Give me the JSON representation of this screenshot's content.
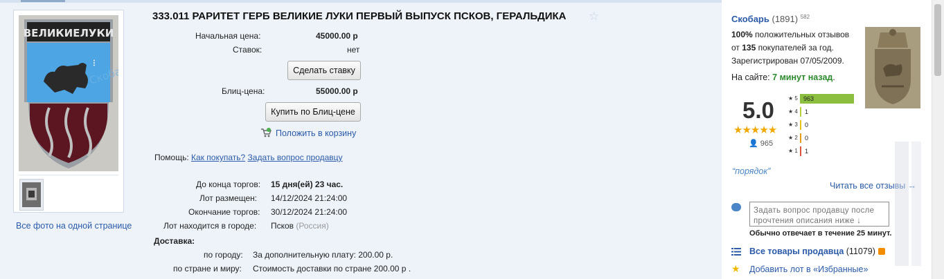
{
  "lot": {
    "title": "333.011 РАРИТЕТ ГЕРБ ВЕЛИКИЕ ЛУКИ ПЕРВЫЙ ВЫПУСК ПСКОВ, ГЕРАЛЬДИКА",
    "image_text": "ВЕЛИКИЕЛУКИ",
    "image_watermark": "Скобарь",
    "all_photos_link": "Все фото на одной странице"
  },
  "pricing": {
    "start_price_label": "Начальная цена:",
    "start_price_value": "45000.00 р",
    "bids_label": "Ставок:",
    "bids_value": "нет",
    "bid_button": "Сделать ставку",
    "blitz_label": "Блиц-цена:",
    "blitz_value": "55000.00 р",
    "blitz_button": "Купить по Блиц-цене",
    "cart_link": "Положить в корзину"
  },
  "help": {
    "label": "Помощь:",
    "how_to_buy": "Как покупать?",
    "ask_seller": "Задать вопрос продавцу"
  },
  "timing": {
    "ends_in_label": "До конца торгов:",
    "ends_in_value": "15 дня(ей) 23 час.",
    "placed_label": "Лот размещен:",
    "placed_value": "14/12/2024 21:24:00",
    "end_label": "Окончание торгов:",
    "end_value": "30/12/2024 21:24:00",
    "city_label": "Лот находится в городе:",
    "city_value": "Псков",
    "country_value": "(Россия)"
  },
  "delivery": {
    "heading": "Доставка:",
    "city_label": "по городу:",
    "city_value": "За дополнительную плату: 200.00 р.",
    "country_label": "по стране и миру:",
    "country_value": "Стоимость доставки по стране 200.00 р ."
  },
  "seller": {
    "name": "Скобарь",
    "count": "(1891)",
    "sup": "582",
    "positive_pct": "100%",
    "positive_text": "положительных отзывов",
    "from_prefix": "от",
    "buyers_count": "135",
    "from_suffix": "покупателей за год.",
    "registered": "Зарегистрирован 07/05/2009.",
    "online_label": "На сайте:",
    "online_value": "7 минут назад",
    "online_dot": "."
  },
  "rating": {
    "score": "5.0",
    "stars": "★★★★★",
    "votes": "965",
    "histogram": [
      {
        "star": "★ 5",
        "count": "963",
        "fraction": 1.0,
        "color": "#8cbf3f"
      },
      {
        "star": "★ 4",
        "count": "1",
        "fraction": 0.03,
        "color": "#b6cf3a"
      },
      {
        "star": "★ 3",
        "count": "0",
        "fraction": 0.03,
        "color": "#e8c21a"
      },
      {
        "star": "★ 2",
        "count": "0",
        "fraction": 0.03,
        "color": "#e89a1a"
      },
      {
        "star": "★ 1",
        "count": "1",
        "fraction": 0.03,
        "color": "#d9543a"
      }
    ],
    "review_quote": "“порядок”",
    "read_all": "Читать все отзывы →"
  },
  "contact": {
    "ask_placeholder": "Задать вопрос продавцу после прочтения описания ниже ↓",
    "reply_time": "Обычно отвечает в течение 25 минут."
  },
  "links": {
    "all_lots": "Все товары продавца",
    "all_lots_count": "(11079)",
    "add_fav": "Добавить лот в «Избранные»"
  },
  "colors": {
    "link": "#2a5aa8",
    "online_green": "#2b8a2b",
    "star": "#f1a800",
    "page_bg": "#eef3fa"
  }
}
